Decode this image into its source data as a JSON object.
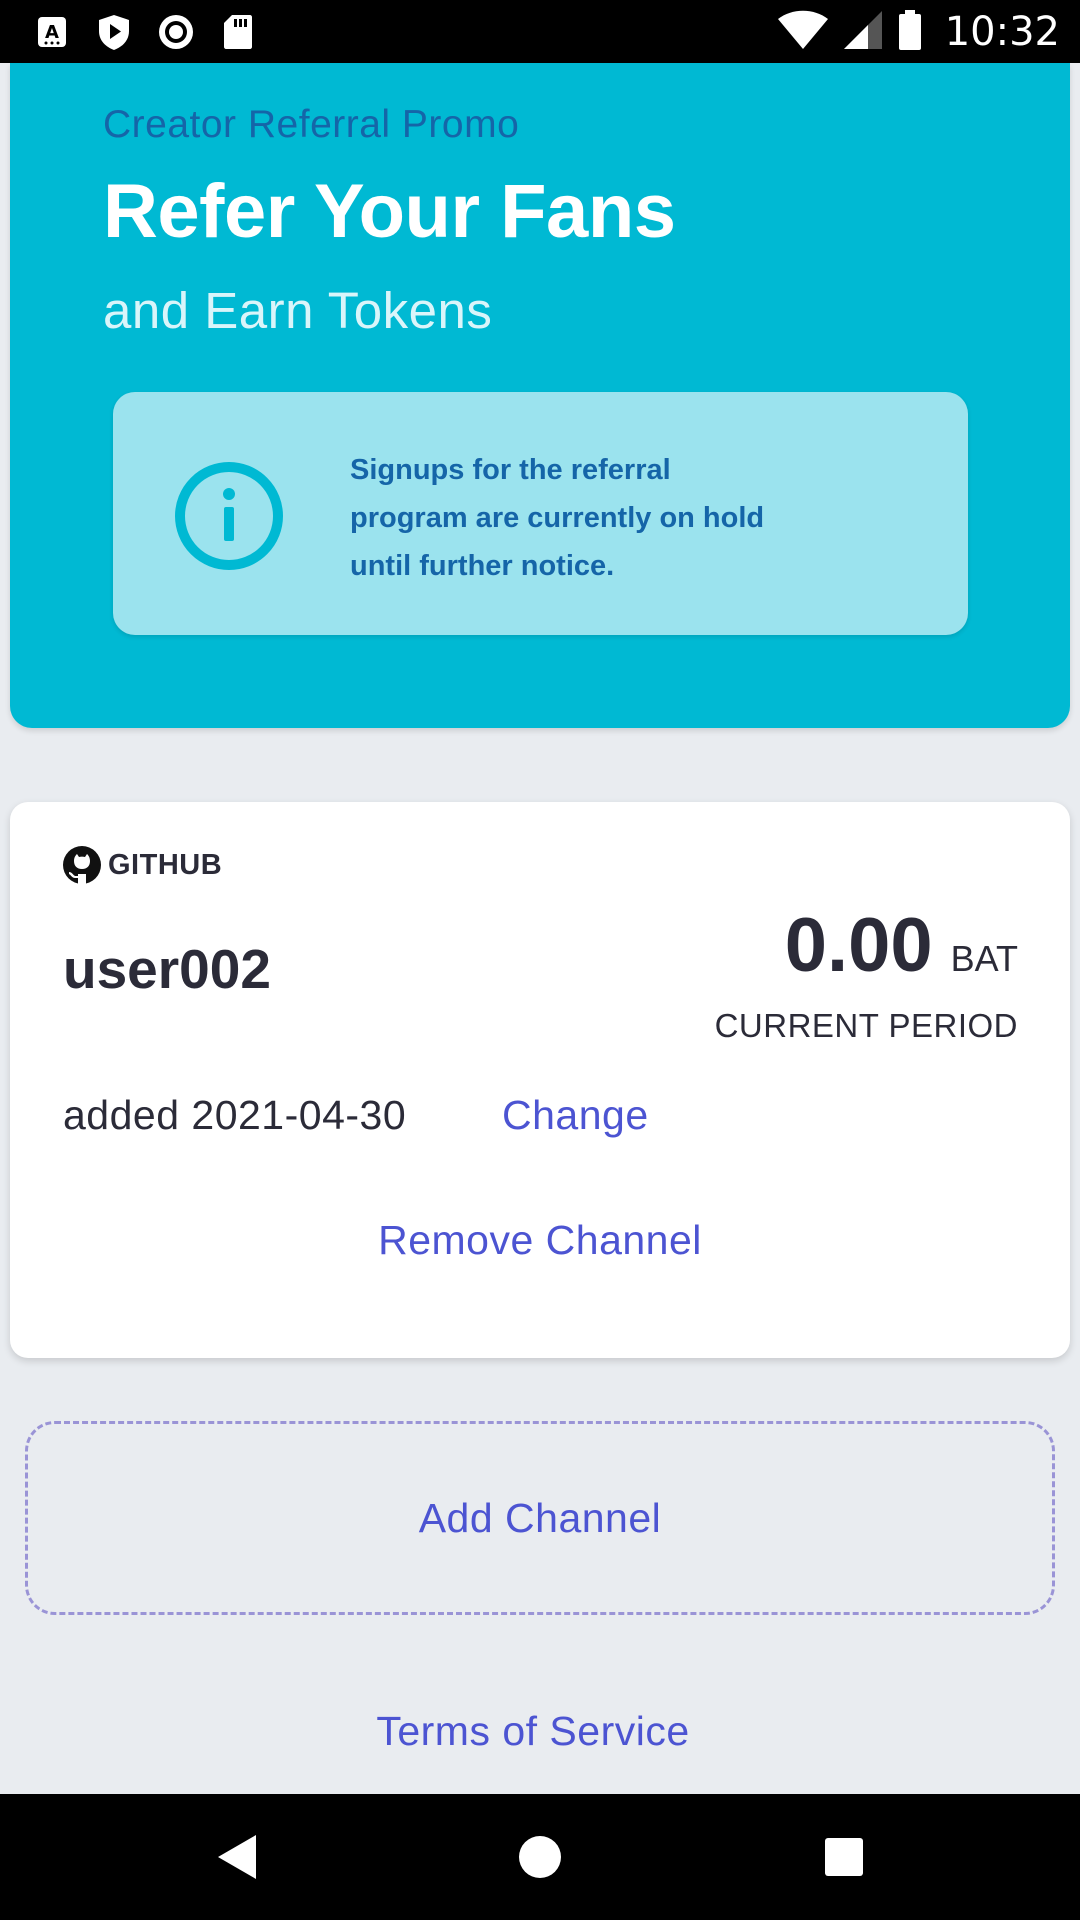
{
  "status_bar": {
    "time": "10:32",
    "left_icons": [
      "accessibility-icon",
      "shield-play-icon",
      "record-icon",
      "sd-card-icon"
    ],
    "right_icons": [
      "wifi-icon",
      "cell-signal-icon",
      "battery-icon"
    ]
  },
  "hero": {
    "promo_label": "Creator Referral Promo",
    "title": "Refer Your Fans",
    "subtitle": "and Earn Tokens",
    "notice_text": "Signups for the referral program are currently on hold until further notice.",
    "notice_icon": "info-icon"
  },
  "channel": {
    "platform_icon": "github-icon",
    "platform": "GITHUB",
    "username": "user002",
    "balance": "0.00",
    "currency": "BAT",
    "period_label": "CURRENT PERIOD",
    "added_text": "added 2021-04-30",
    "change_label": "Change",
    "remove_label": "Remove Channel"
  },
  "add_channel_label": "Add Channel",
  "terms_label": "Terms of Service",
  "nav": {
    "back_icon": "back-triangle-icon",
    "home_icon": "home-circle-icon",
    "recents_icon": "recents-square-icon"
  },
  "colors": {
    "hero_bg": "#00b9d3",
    "notice_bg": "#9be3ee",
    "accent_blue_text": "#1565a8",
    "link": "#4c54d2",
    "page_bg": "#e9ecf0"
  }
}
